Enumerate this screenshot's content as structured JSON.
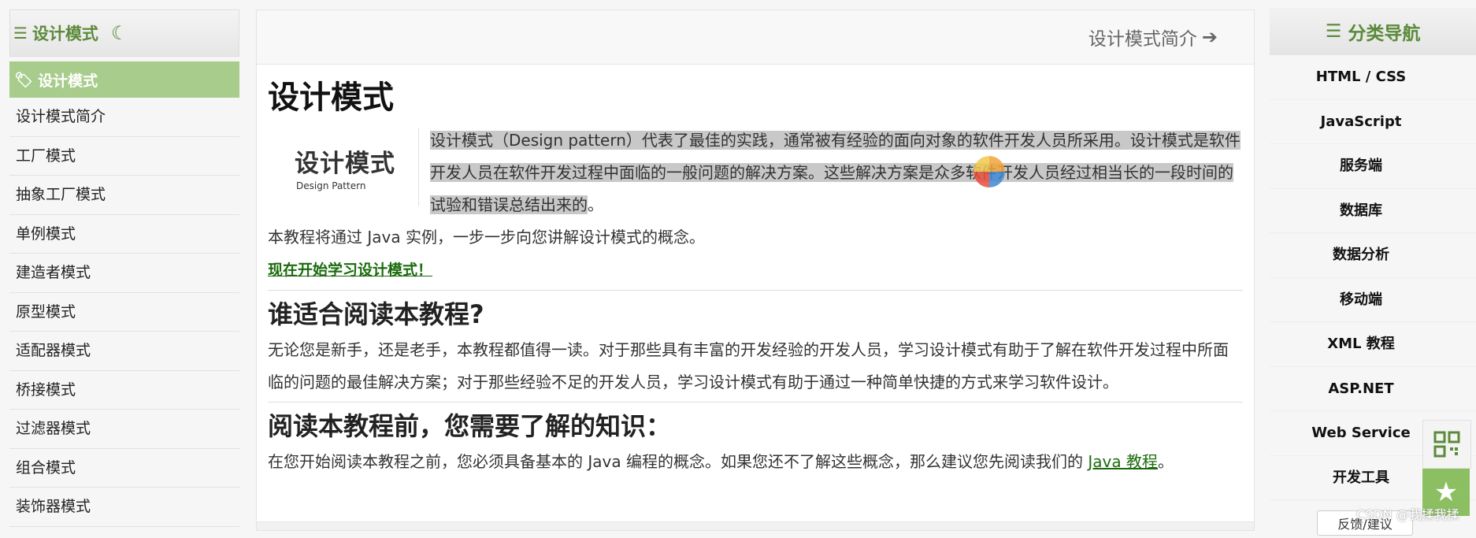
{
  "left_sidebar": {
    "title": "设计模式",
    "active_item": "设计模式",
    "items": [
      "设计模式简介",
      "工厂模式",
      "抽象工厂模式",
      "单例模式",
      "建造者模式",
      "原型模式",
      "适配器模式",
      "桥接模式",
      "过滤器模式",
      "组合模式",
      "装饰器模式"
    ]
  },
  "top_nav": {
    "next_label": "设计模式简介"
  },
  "main": {
    "title": "设计模式",
    "logo_big": "设计模式",
    "logo_small": "Design Pattern",
    "intro_highlight": "设计模式（Design pattern）代表了最佳的实践，通常被有经验的面向对象的软件开发人员所采用。设计模式是软件开发人员在软件开发过程中面临的一般问题的解决方案。这些解决方案是众多软件开发人员经过相当长的一段时间的试验和错误总结出来的",
    "intro_tail": "。",
    "java_line": "本教程将通过 Java 实例，一步一步向您讲解设计模式的概念。",
    "start_link": "现在开始学习设计模式！",
    "sec1_title": "谁适合阅读本教程?",
    "sec1_text": "无论您是新手，还是老手，本教程都值得一读。对于那些具有丰富的开发经验的开发人员，学习设计模式有助于了解在软件开发过程中所面临的问题的最佳解决方案；对于那些经验不足的开发人员，学习设计模式有助于通过一种简单快捷的方式来学习软件设计。",
    "sec2_title": "阅读本教程前，您需要了解的知识：",
    "sec2_text_pre": "在您开始阅读本教程之前，您必须具备基本的 Java 编程的概念。如果您还不了解这些概念，那么建议您先阅读我们的 ",
    "sec2_link": "Java 教程",
    "sec2_text_post": "。"
  },
  "right_sidebar": {
    "title": "分类导航",
    "items": [
      "HTML / CSS",
      "JavaScript",
      "服务端",
      "数据库",
      "数据分析",
      "移动端",
      "XML 教程",
      "ASP.NET",
      "Web Service",
      "开发工具"
    ]
  },
  "feedback": "反馈/建议",
  "watermark": "CSDN @我揉我揉",
  "colors": {
    "accent": "#5b8a3a",
    "active_bg": "#a8cc8c",
    "link": "#1b6b0d",
    "highlight": "#c8c8c8"
  },
  "icons": {
    "list": "list-icon",
    "moon": "moon-icon",
    "tag": "tag-icon",
    "arrow": "arrow-right-icon",
    "qr": "qrcode-icon",
    "star": "star-icon"
  }
}
